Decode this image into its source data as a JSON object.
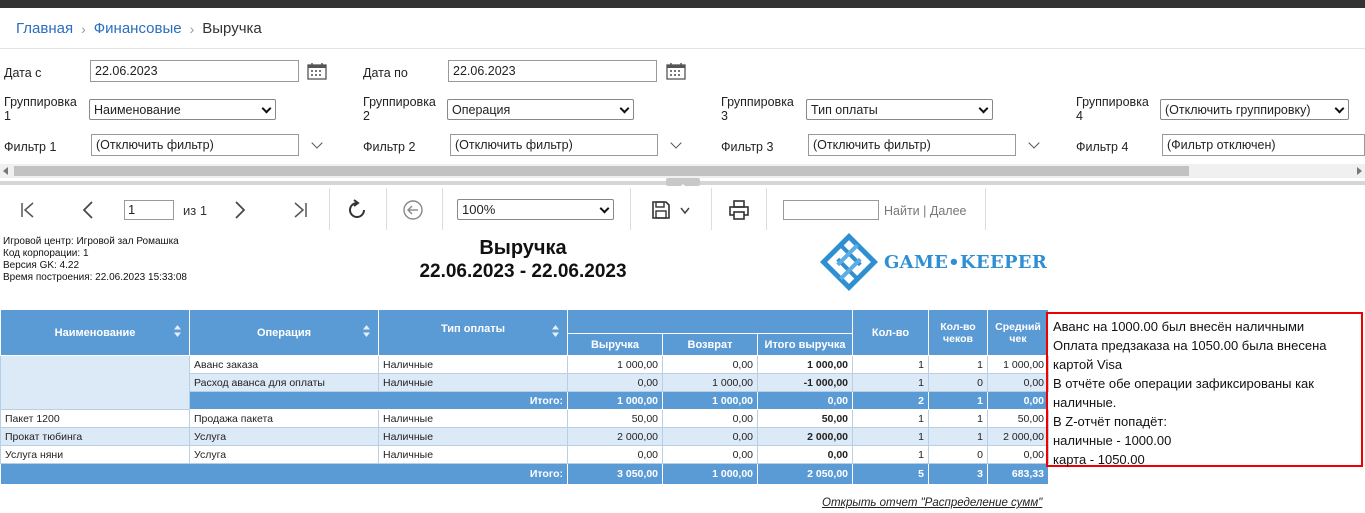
{
  "breadcrumb": {
    "home": "Главная",
    "finance": "Финансовые",
    "current": "Выручка"
  },
  "filters": {
    "date_from_label": "Дата с",
    "date_from_value": "22.06.2023",
    "date_to_label": "Дата по",
    "date_to_value": "22.06.2023",
    "group1_label": "Группировка\n1",
    "group1_value": "Наименование",
    "group2_label": "Группировка\n2",
    "group2_value": "Операция",
    "group3_label": "Группировка\n3",
    "group3_value": "Тип оплаты",
    "group4_label": "Группировка\n4",
    "group4_value": "(Отключить группировку)",
    "filter1_label": "Фильтр 1",
    "filter1_value": "(Отключить фильтр)",
    "filter2_label": "Фильтр 2",
    "filter2_value": "(Отключить фильтр)",
    "filter3_label": "Фильтр 3",
    "filter3_value": "(Отключить фильтр)",
    "filter4_label": "Фильтр 4",
    "filter4_value": "(Фильтр отключен)"
  },
  "toolbar": {
    "page_value": "1",
    "page_of": "из 1",
    "zoom": "100%",
    "find_label": "Найти",
    "find_sep": "|",
    "next_label": "Далее"
  },
  "report": {
    "info": [
      "Игровой центр: Игровой зал Ромашка",
      "Код корпорации: 1",
      "Версия GK: 4.22",
      "Время построения: 22.06.2023 15:33:08"
    ],
    "title": "Выручка",
    "period": "22.06.2023 - 22.06.2023",
    "logo_text": "GAME•KEEPER",
    "headers": {
      "name": "Наименование",
      "operation": "Операция",
      "payment": "Тип оплаты",
      "revenue": "Выручка",
      "refund": "Возврат",
      "total_revenue": "Итого выручка",
      "qty": "Кол-во",
      "checks": "Кол-во чеков",
      "avg": "Средний чек"
    },
    "rows": [
      {
        "name": "",
        "op": "Аванс заказа",
        "pay": "Наличные",
        "rev": "1 000,00",
        "ret": "0,00",
        "tot": "1 000,00",
        "qty": "1",
        "chk": "1",
        "avg": "1 000,00"
      },
      {
        "name": "",
        "op": "Расход аванса для оплаты",
        "pay": "Наличные",
        "rev": "0,00",
        "ret": "1 000,00",
        "tot": "-1 000,00",
        "qty": "1",
        "chk": "0",
        "avg": "0,00"
      },
      {
        "label": "Итого:",
        "rev": "1 000,00",
        "ret": "1 000,00",
        "tot": "0,00",
        "qty": "2",
        "chk": "1",
        "avg": "0,00"
      },
      {
        "name": "Пакет 1200",
        "op": "Продажа пакета",
        "pay": "Наличные",
        "rev": "50,00",
        "ret": "0,00",
        "tot": "50,00",
        "qty": "1",
        "chk": "1",
        "avg": "50,00"
      },
      {
        "name": "Прокат тюбинга",
        "op": "Услуга",
        "pay": "Наличные",
        "rev": "2 000,00",
        "ret": "0,00",
        "tot": "2 000,00",
        "qty": "1",
        "chk": "1",
        "avg": "2 000,00"
      },
      {
        "name": "Услуга няни",
        "op": "Услуга",
        "pay": "Наличные",
        "rev": "0,00",
        "ret": "0,00",
        "tot": "0,00",
        "qty": "1",
        "chk": "0",
        "avg": "0,00"
      }
    ],
    "total": {
      "label": "Итого:",
      "rev": "3 050,00",
      "ret": "1 000,00",
      "tot": "2 050,00",
      "qty": "5",
      "chk": "3",
      "avg": "683,33"
    },
    "link": "Открыть отчет \"Распределение сумм\""
  },
  "note": {
    "text": "Аванс на 1000.00 был внесён наличными\nОплата предзаказа на 1050.00 была внесена картой Visa\nВ отчёте обе операции зафиксированы как\n наличные.\nВ Z-отчёт попадёт:\nналичные - 1000.00\nкарта - 1050.00"
  },
  "colors": {
    "header_blue": "#5b9bd5",
    "row_alt": "#dce9f6",
    "link_blue": "#2a6ebf",
    "note_border": "#e00000"
  }
}
